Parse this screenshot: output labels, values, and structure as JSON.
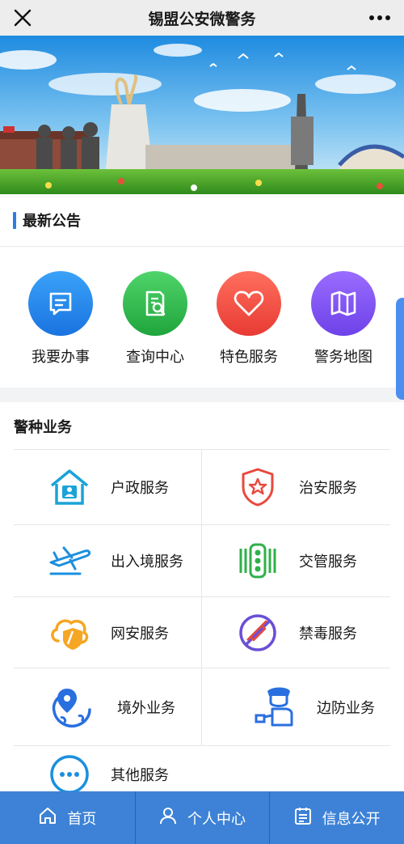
{
  "header": {
    "title": "锡盟公安微警务",
    "close_icon": "close-icon",
    "more_icon": "more-dots-icon"
  },
  "banner": {
    "alt_text": "元上都遗址"
  },
  "notice": {
    "title": "最新公告"
  },
  "quick_services": [
    {
      "label": "我要办事",
      "icon": "message-icon",
      "color": "#2f8ef5"
    },
    {
      "label": "查询中心",
      "icon": "document-search-icon",
      "color": "#2fc24f"
    },
    {
      "label": "特色服务",
      "icon": "heart-icon",
      "color": "#f0564a"
    },
    {
      "label": "警务地图",
      "icon": "map-icon",
      "color": "#8a5cf0"
    }
  ],
  "police_section": {
    "title": "警种业务",
    "items": [
      {
        "label": "户政服务",
        "icon": "house-person-icon"
      },
      {
        "label": "治安服务",
        "icon": "shield-star-icon"
      },
      {
        "label": "出入境服务",
        "icon": "airplane-icon"
      },
      {
        "label": "交管服务",
        "icon": "traffic-light-icon"
      },
      {
        "label": "网安服务",
        "icon": "cloud-shield-icon"
      },
      {
        "label": "禁毒服务",
        "icon": "no-drugs-icon"
      },
      {
        "label": "境外业务",
        "icon": "globe-pin-icon"
      },
      {
        "label": "边防业务",
        "icon": "border-officer-icon"
      },
      {
        "label": "其他服务",
        "icon": "more-chat-icon"
      }
    ]
  },
  "tabbar": [
    {
      "label": "首页",
      "icon": "home-icon"
    },
    {
      "label": "个人中心",
      "icon": "user-icon"
    },
    {
      "label": "信息公开",
      "icon": "calendar-list-icon"
    }
  ]
}
